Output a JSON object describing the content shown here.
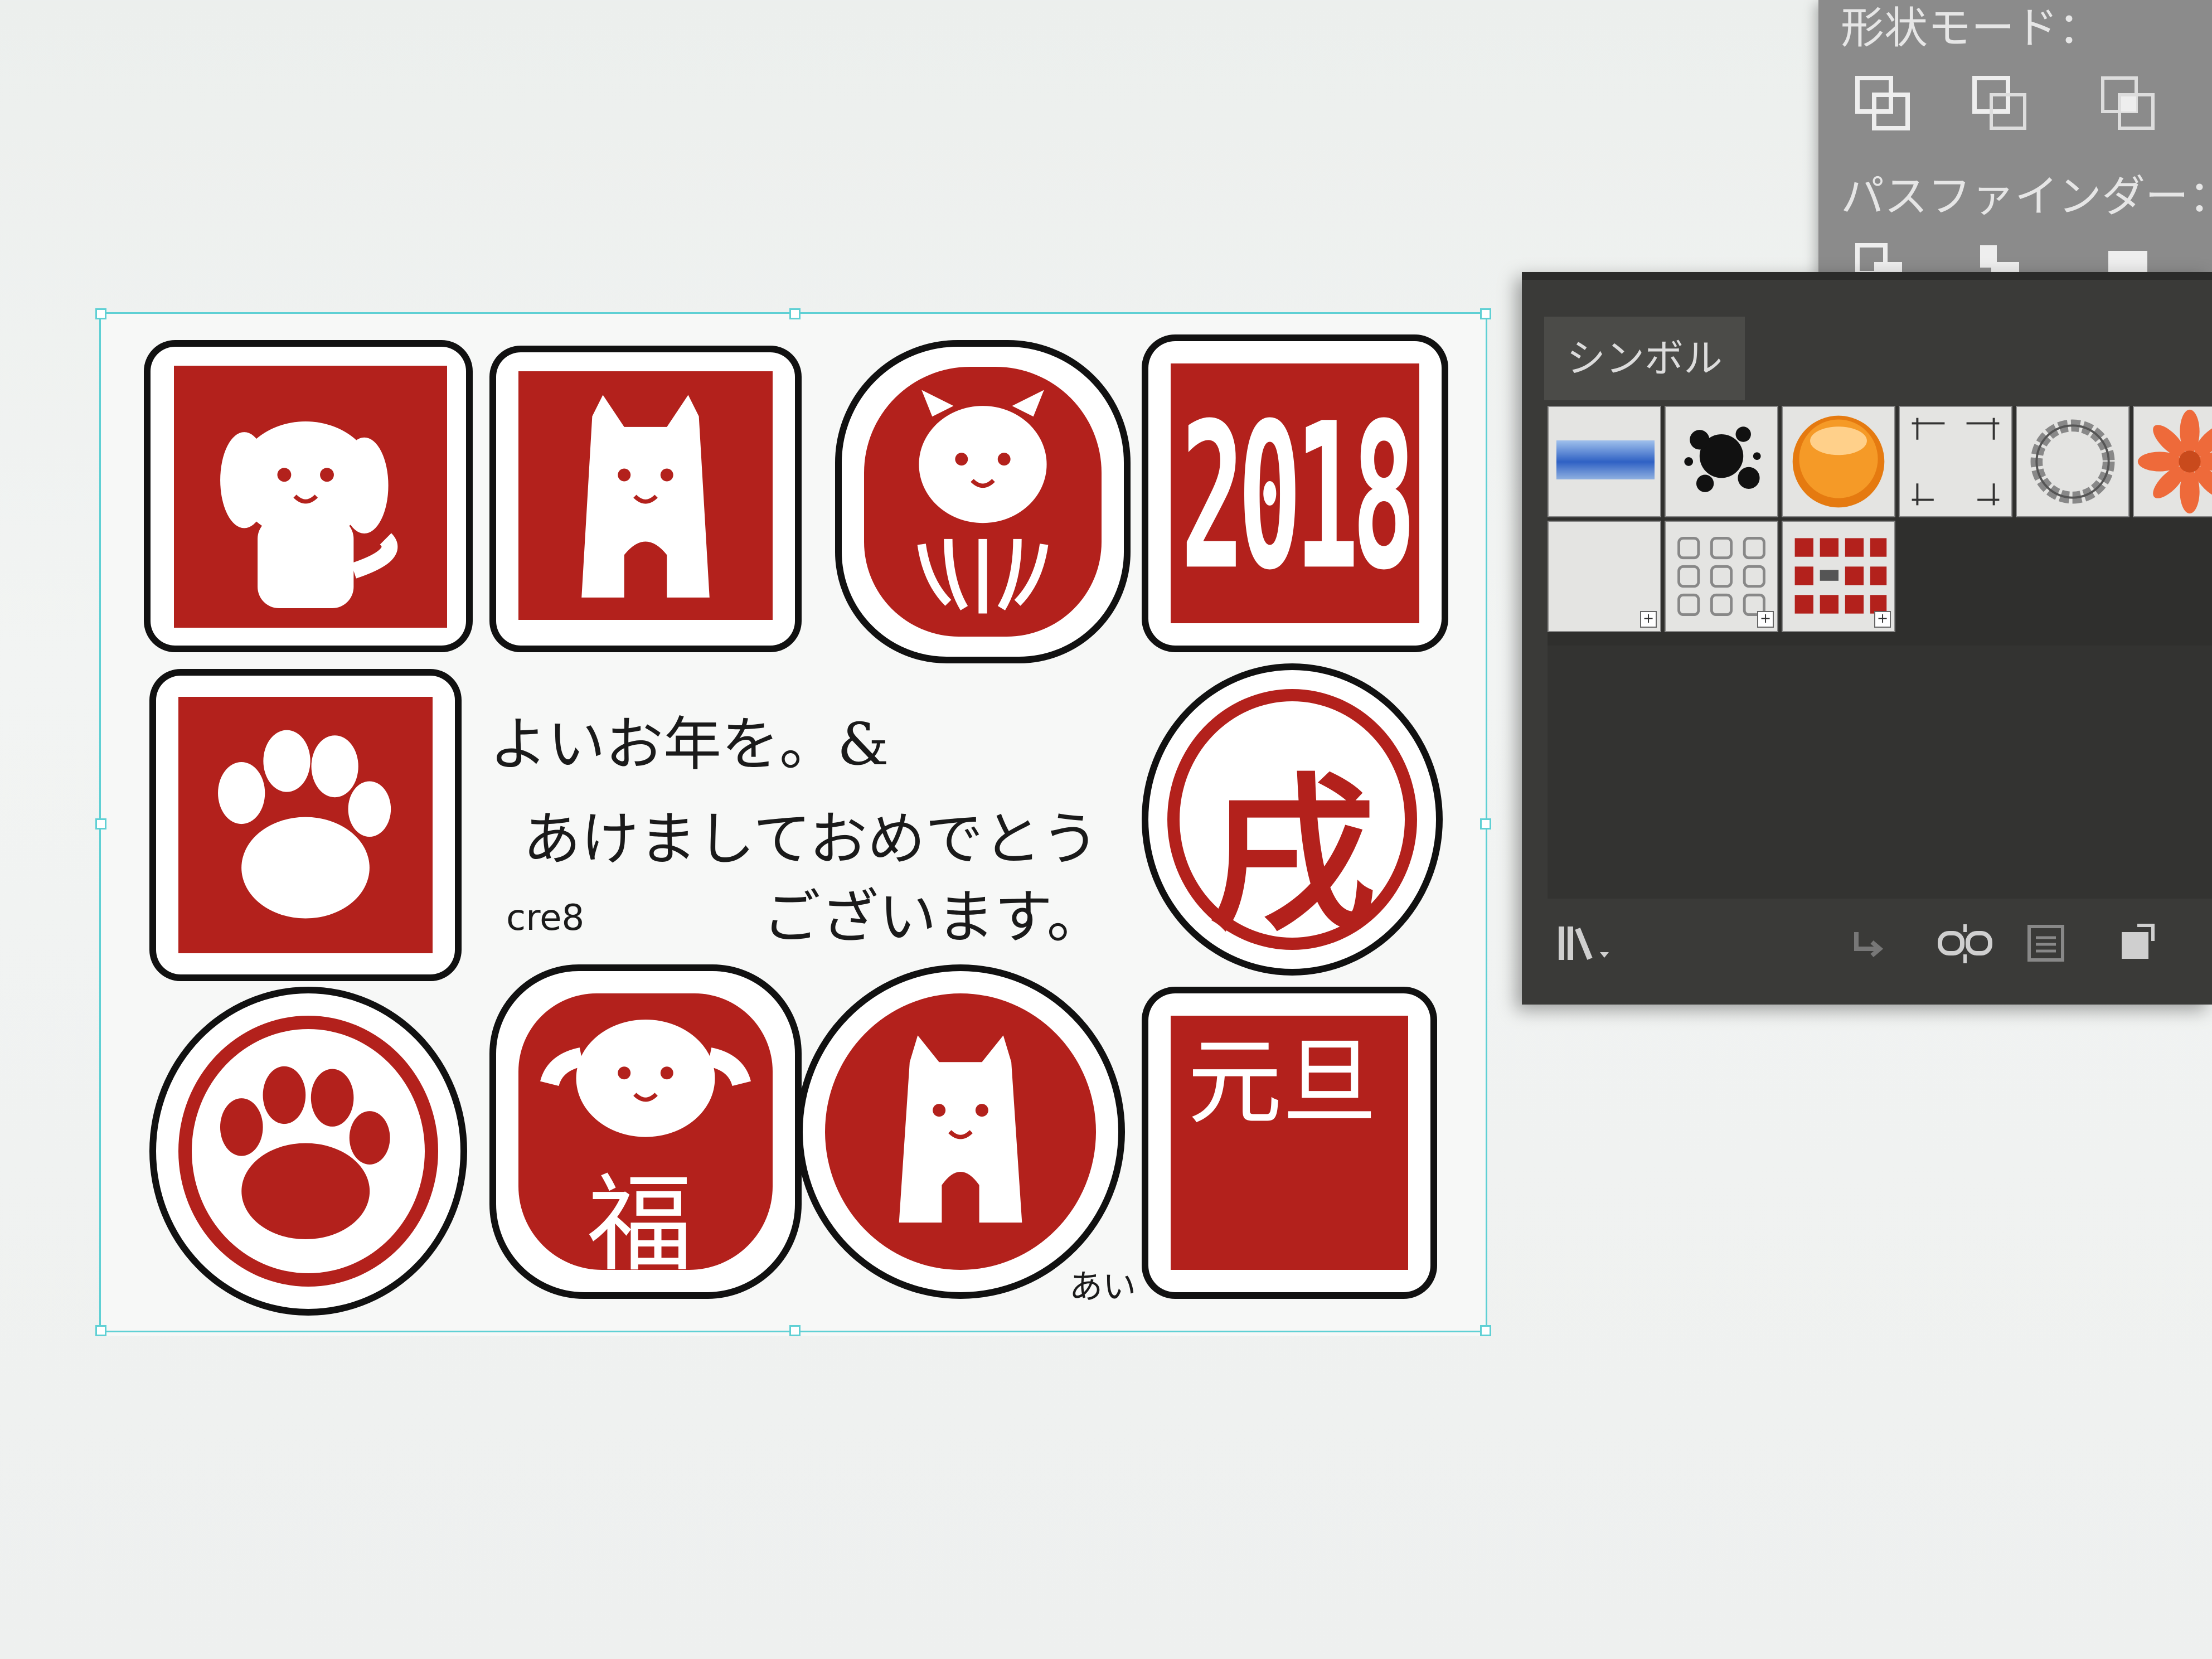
{
  "pathfinder_panel": {
    "shape_mode_label": "形状モード：",
    "pathfinder_label": "パスファインダー：",
    "shape_mode_icons": [
      "unite-icon",
      "minus-front-icon",
      "intersect-icon"
    ],
    "pathfinder_icons": [
      "divide-icon",
      "trim-icon",
      "merge-icon"
    ]
  },
  "symbols_panel": {
    "tab_label": "シンボル",
    "symbols": [
      {
        "name": "blue-gradient-bar-symbol"
      },
      {
        "name": "ink-splatter-symbol"
      },
      {
        "name": "orange-button-symbol"
      },
      {
        "name": "crop-marks-symbol"
      },
      {
        "name": "wreath-ring-symbol"
      },
      {
        "name": "flower-symbol"
      },
      {
        "name": "blank-symbol"
      },
      {
        "name": "grid-frames-symbol"
      },
      {
        "name": "stamp-set-symbol"
      }
    ],
    "footer_icons": [
      "symbol-library-menu-icon",
      "place-symbol-icon",
      "break-link-icon",
      "symbol-options-icon",
      "new-symbol-icon"
    ]
  },
  "card": {
    "greeting_line1": "よいお年を。&",
    "greeting_line2": "あけましておめでとう",
    "greeting_line3": "ございます。",
    "credit": "cre8",
    "signature": "あい",
    "year_stamp": "2018",
    "zodiac_stamp": "戌",
    "fortune_stamp": "福",
    "new_year_stamp": "元旦"
  },
  "colors": {
    "stamp_red": "#b3211c",
    "selection": "#5fd0d4",
    "panel_dark": "#3a3a38"
  }
}
